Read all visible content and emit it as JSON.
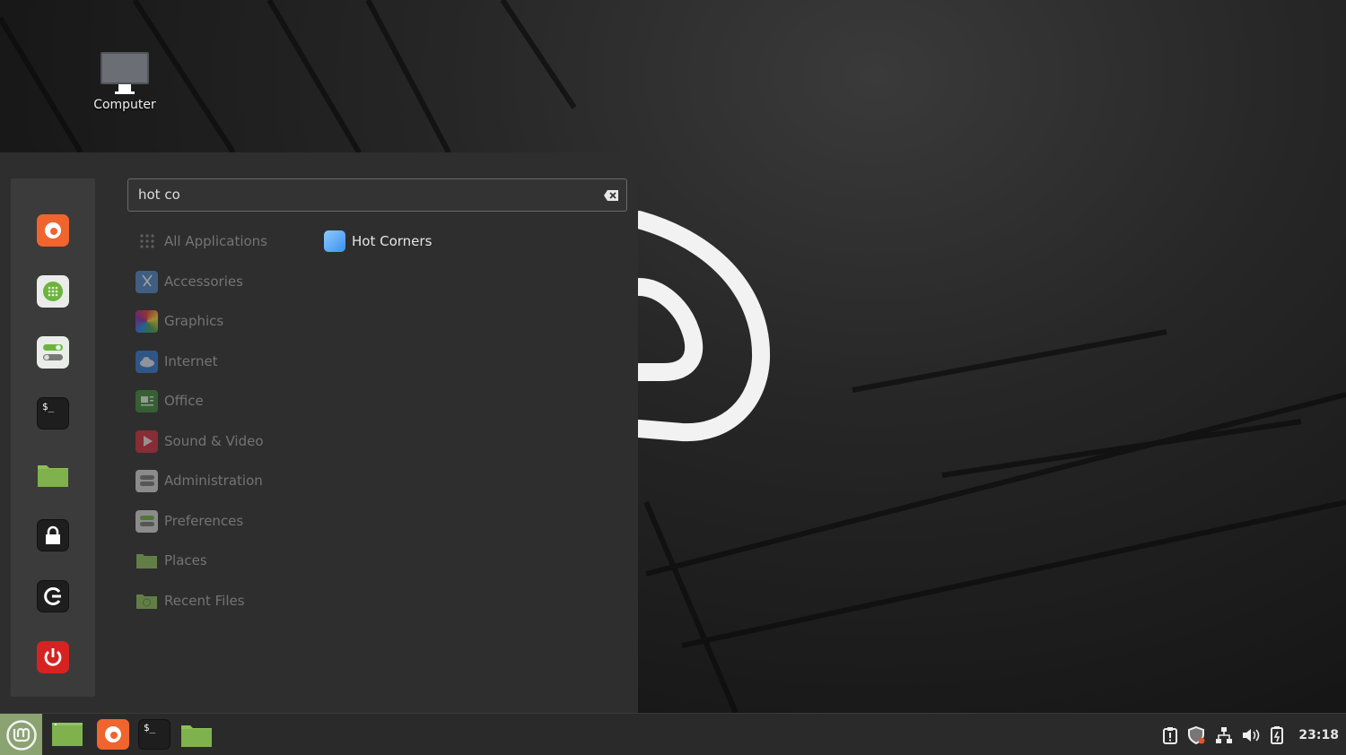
{
  "desktop": {
    "icons": [
      {
        "label": "Computer",
        "icon": "computer-icon"
      }
    ]
  },
  "menu": {
    "search": {
      "value": "hot co",
      "placeholder": ""
    },
    "favorites": [
      {
        "name": "Firefox",
        "icon": "firefox-icon"
      },
      {
        "name": "Software Manager",
        "icon": "software-manager-icon"
      },
      {
        "name": "System Settings",
        "icon": "settings-toggle-icon"
      },
      {
        "name": "Terminal",
        "icon": "terminal-icon"
      },
      {
        "name": "Files",
        "icon": "folder-icon"
      },
      {
        "name": "Lock Screen",
        "icon": "lock-icon"
      },
      {
        "name": "Log Out",
        "icon": "logout-icon"
      },
      {
        "name": "Quit",
        "icon": "power-icon"
      }
    ],
    "categories": [
      {
        "label": "All Applications",
        "icon": "grid-icon"
      },
      {
        "label": "Accessories",
        "icon": "scissors-icon"
      },
      {
        "label": "Graphics",
        "icon": "palette-icon"
      },
      {
        "label": "Internet",
        "icon": "cloud-icon"
      },
      {
        "label": "Office",
        "icon": "document-icon"
      },
      {
        "label": "Sound & Video",
        "icon": "play-icon"
      },
      {
        "label": "Administration",
        "icon": "toggle-icon"
      },
      {
        "label": "Preferences",
        "icon": "toggle-green-icon"
      },
      {
        "label": "Places",
        "icon": "folder-icon"
      },
      {
        "label": "Recent Files",
        "icon": "recent-folder-icon"
      }
    ],
    "results": [
      {
        "label": "Hot Corners",
        "icon": "hot-corners-icon"
      }
    ]
  },
  "panel": {
    "launchers": [
      {
        "name": "Show Desktop",
        "icon": "show-desktop-icon"
      },
      {
        "name": "Firefox",
        "icon": "firefox-icon"
      },
      {
        "name": "Terminal",
        "icon": "terminal-icon"
      },
      {
        "name": "Files",
        "icon": "folder-icon"
      }
    ],
    "tray": [
      {
        "name": "Notifications",
        "icon": "clipboard-alert-icon"
      },
      {
        "name": "Update Manager",
        "icon": "shield-icon"
      },
      {
        "name": "Network",
        "icon": "network-icon"
      },
      {
        "name": "Volume",
        "icon": "volume-icon"
      },
      {
        "name": "Power",
        "icon": "battery-icon"
      }
    ],
    "clock": "23:18"
  },
  "colors": {
    "accent": "#8aa371",
    "menu_bg": "#2e2e2e",
    "panel_bg": "#2a2a2a"
  }
}
